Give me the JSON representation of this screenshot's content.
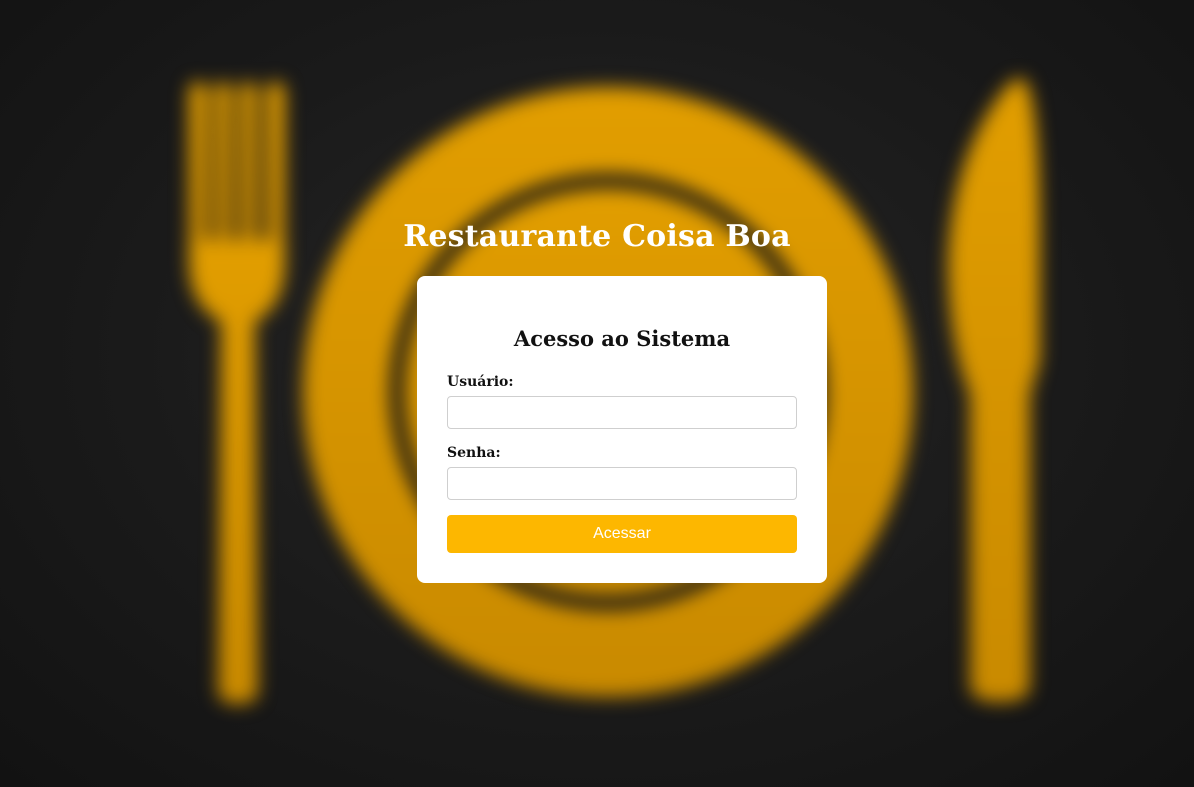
{
  "page": {
    "title": "Restaurante Coisa Boa"
  },
  "login": {
    "heading": "Acesso ao Sistema",
    "username_label": "Usuário:",
    "username_value": "",
    "password_label": "Senha:",
    "password_value": "",
    "submit_label": "Acessar"
  },
  "background": {
    "depicts": [
      "fork-icon",
      "plate-icon",
      "knife-icon"
    ]
  },
  "colors": {
    "background": "#151515",
    "art": "#e0a000",
    "button": "#fdb700",
    "card": "#ffffff"
  }
}
